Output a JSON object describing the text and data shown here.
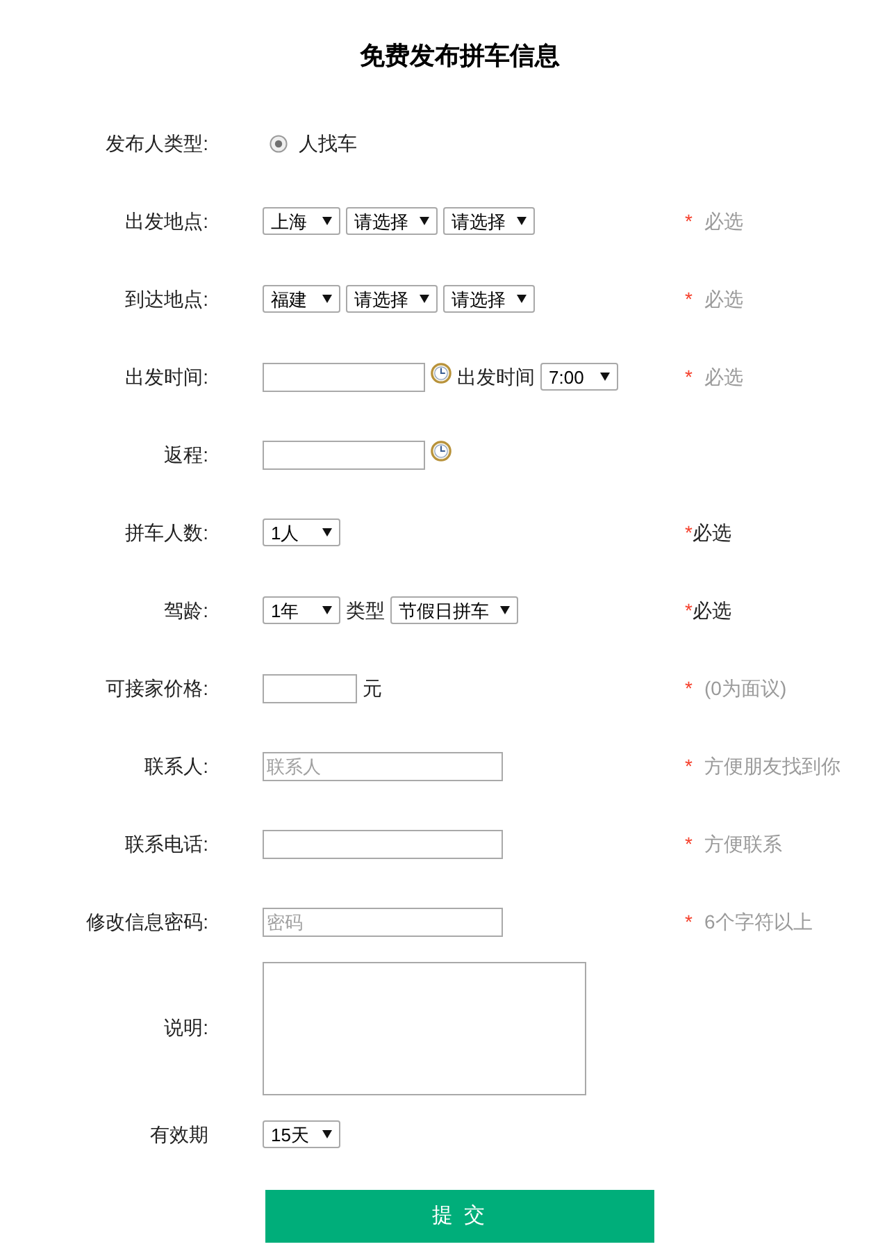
{
  "title": "免费发布拼车信息",
  "fields": [
    {
      "label": "发布人类型:",
      "controls": [
        {
          "kind": "radio",
          "options": [
            {
              "label": "人找车",
              "selected": true
            }
          ]
        }
      ]
    },
    {
      "label": "出发地点:",
      "controls": [
        {
          "kind": "select",
          "value": "上海"
        },
        {
          "kind": "select",
          "value": "请选择"
        },
        {
          "kind": "select",
          "value": "请选择"
        }
      ],
      "hint": {
        "mark": "*",
        "text": "必选",
        "muted": true
      }
    },
    {
      "label": "到达地点:",
      "controls": [
        {
          "kind": "select",
          "value": "福建"
        },
        {
          "kind": "select",
          "value": "请选择"
        },
        {
          "kind": "select",
          "value": "请选择"
        }
      ],
      "hint": {
        "mark": "*",
        "text": "必选",
        "muted": true
      }
    },
    {
      "label": "出发时间:",
      "controls": [
        {
          "kind": "date"
        },
        {
          "kind": "text",
          "text": "出发时间"
        },
        {
          "kind": "select",
          "value": "7:00"
        }
      ],
      "hint": {
        "mark": "*",
        "text": "必选",
        "muted": true
      }
    },
    {
      "label": "返程:",
      "controls": [
        {
          "kind": "date"
        }
      ]
    },
    {
      "label": "拼车人数:",
      "controls": [
        {
          "kind": "select",
          "value": "1人"
        }
      ],
      "hint": {
        "mark": "*",
        "text": "必选",
        "muted": false
      }
    },
    {
      "label": "驾龄:",
      "controls": [
        {
          "kind": "select",
          "value": "1年"
        },
        {
          "kind": "text",
          "text": "类型"
        },
        {
          "kind": "select",
          "value": "节假日拼车"
        }
      ],
      "hint": {
        "mark": "*",
        "text": "必选",
        "muted": false
      }
    },
    {
      "label": "可接家价格:",
      "controls": [
        {
          "kind": "number"
        },
        {
          "kind": "text",
          "text": "元"
        }
      ],
      "hint": {
        "mark": "*",
        "text": "(0为面议)",
        "muted": true
      }
    },
    {
      "label": "联系人:",
      "controls": [
        {
          "kind": "input",
          "placeholder": "联系人"
        }
      ],
      "hint": {
        "mark": "*",
        "text": "方便朋友找到你",
        "muted": true
      }
    },
    {
      "label": "联系电话:",
      "controls": [
        {
          "kind": "input"
        }
      ],
      "hint": {
        "mark": "*",
        "text": "方便联系",
        "muted": true
      }
    },
    {
      "label": "修改信息密码:",
      "controls": [
        {
          "kind": "password",
          "placeholder": "密码"
        }
      ],
      "hint": {
        "mark": "*",
        "text": "6个字符以上",
        "muted": true
      }
    },
    {
      "label": "说明:",
      "controls": [
        {
          "kind": "textarea"
        }
      ]
    },
    {
      "label": "有效期",
      "controls": [
        {
          "kind": "select",
          "value": "15天"
        }
      ]
    }
  ],
  "submit": "提 交"
}
